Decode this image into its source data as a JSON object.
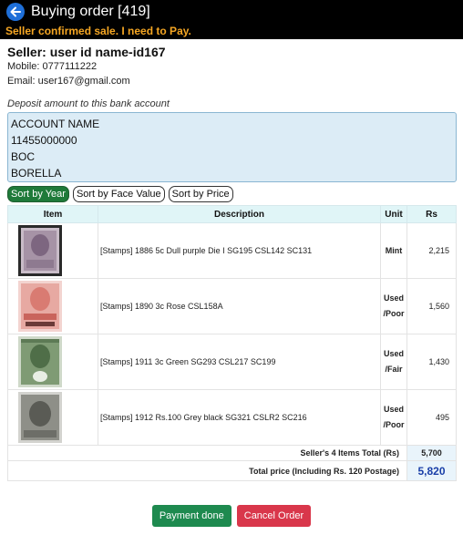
{
  "header": {
    "title": "Buying order [419]",
    "status": "Seller confirmed sale. I need to Pay."
  },
  "seller": {
    "name": "Seller: user id name-id167",
    "mobile": "Mobile: 0777111222",
    "email": "Email: user167@gmail.com"
  },
  "bank": {
    "label": "Deposit amount to this bank account",
    "lines": [
      "ACCOUNT NAME",
      "11455000000",
      "BOC",
      "BORELLA"
    ]
  },
  "sort": {
    "by_year": "Sort by Year",
    "by_face_value": "Sort by Face Value",
    "by_price": "Sort by Price",
    "active": "by_year"
  },
  "table": {
    "headers": {
      "item": "Item",
      "description": "Description",
      "unit": "Unit",
      "rs": "Rs"
    },
    "rows": [
      {
        "description": "[Stamps] 1886 5c Dull purple Die I SG195 CSL142 SC131",
        "unit": "Mint",
        "price": "2,215",
        "stamp_icon": "stamp-purple-icon"
      },
      {
        "description": "[Stamps] 1890 3c Rose CSL158A",
        "unit": "Used /Poor",
        "price": "1,560",
        "stamp_icon": "stamp-rose-icon"
      },
      {
        "description": "[Stamps] 1911 3c Green SG293 CSL217 SC199",
        "unit": "Used /Fair",
        "price": "1,430",
        "stamp_icon": "stamp-green-icon"
      },
      {
        "description": "[Stamps] 1912 Rs.100 Grey black SG321 CSLR2 SC216",
        "unit": "Used /Poor",
        "price": "495",
        "stamp_icon": "stamp-grey-icon"
      }
    ],
    "subtotal_label": "Seller's 4 Items Total (Rs)",
    "subtotal_value": "5,700",
    "grand_label": "Total price (Including Rs. 120 Postage)",
    "grand_value": "5,820"
  },
  "actions": {
    "payment_done": "Payment done",
    "cancel_order": "Cancel Order"
  },
  "colors": {
    "mint": "#1f8a2e",
    "used": "#2d63b8",
    "status": "#f5a623",
    "payment_done": "#1e8a4f",
    "cancel_order": "#d9374b"
  }
}
